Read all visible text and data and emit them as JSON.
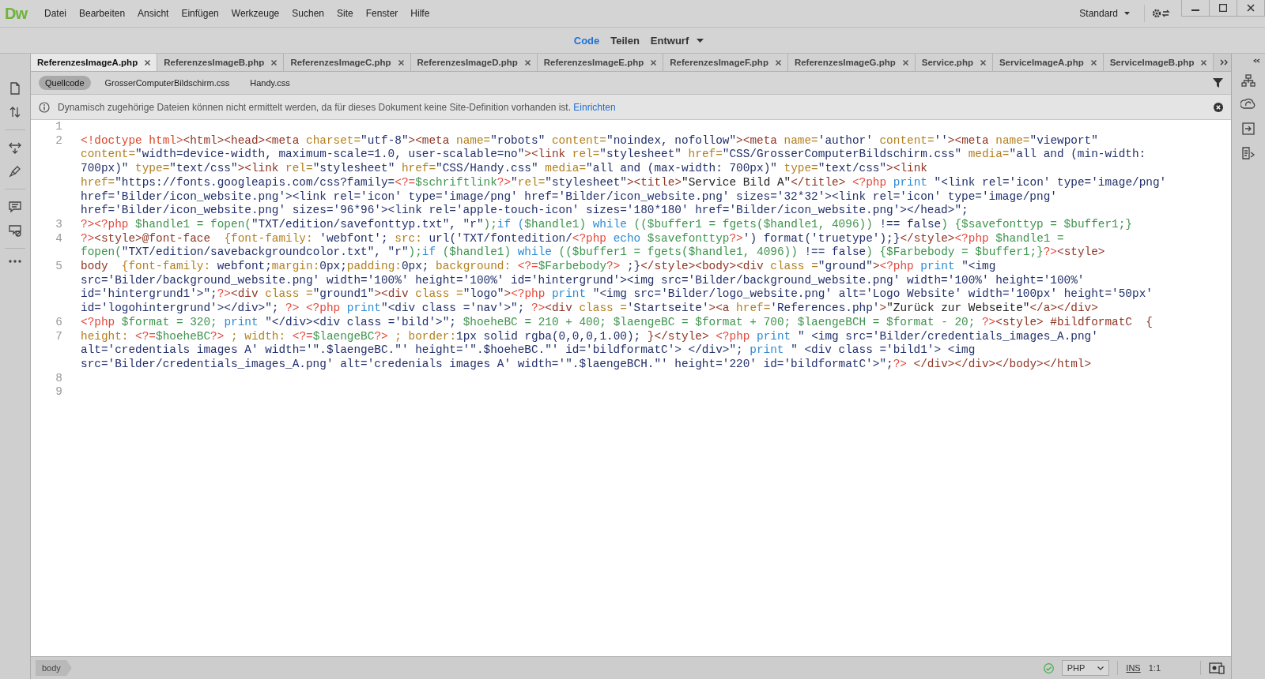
{
  "menu_bar": {
    "logo": "Dw",
    "items": [
      "Datei",
      "Bearbeiten",
      "Ansicht",
      "Einfügen",
      "Werkzeuge",
      "Suchen",
      "Site",
      "Fenster",
      "Hilfe"
    ],
    "workspace": "Standard"
  },
  "view_switch": [
    {
      "label": "Code",
      "selected": true
    },
    {
      "label": "Teilen",
      "selected": false
    },
    {
      "label": "Entwurf",
      "selected": false
    }
  ],
  "document_tabs": [
    {
      "label": "ReferenzesImageA.php",
      "selected": true
    },
    {
      "label": "ReferenzesImageB.php",
      "selected": false
    },
    {
      "label": "ReferenzesImageC.php",
      "selected": false
    },
    {
      "label": "ReferenzesImageD.php",
      "selected": false
    },
    {
      "label": "ReferenzesImageE.php",
      "selected": false
    },
    {
      "label": "ReferenzesImageF.php",
      "selected": false
    },
    {
      "label": "ReferenzesImageG.php",
      "selected": false
    },
    {
      "label": "Service.php",
      "selected": false
    },
    {
      "label": "ServiceImageA.php",
      "selected": false
    },
    {
      "label": "ServiceImageB.php",
      "selected": false
    }
  ],
  "related_files": [
    {
      "label": "Quellcode",
      "selected": true
    },
    {
      "label": "GrosserComputerBildschirm.css",
      "selected": false
    },
    {
      "label": "Handy.css",
      "selected": false
    }
  ],
  "info_bar": {
    "message": "Dynamisch zugehörige Dateien können nicht ermittelt werden, da für dieses Dokument keine Site-Definition vorhanden ist.",
    "link": "Einrichten"
  },
  "code": {
    "lines": [
      {
        "number": "1"
      },
      {
        "number": "2",
        "rows": [
          {
            "tokens": [
              {
                "kind": "doctype",
                "text": "<!doctype html>"
              },
              {
                "kind": "tag",
                "text": "<html><head><meta "
              },
              {
                "kind": "attr",
                "text": "charset="
              },
              {
                "kind": "str",
                "text": "\"utf-8\""
              },
              {
                "kind": "tag",
                "text": "><meta "
              },
              {
                "kind": "attr",
                "text": "name="
              },
              {
                "kind": "str",
                "text": "\"robots\" "
              },
              {
                "kind": "attr",
                "text": "content="
              },
              {
                "kind": "str",
                "text": "\"noindex, nofollow\""
              },
              {
                "kind": "tag",
                "text": "><meta "
              },
              {
                "kind": "attr",
                "text": "name="
              },
              {
                "kind": "str",
                "text": "'author' "
              },
              {
                "kind": "attr",
                "text": "content="
              },
              {
                "kind": "str",
                "text": "''"
              },
              {
                "kind": "tag",
                "text": "><meta "
              },
              {
                "kind": "attr",
                "text": "name="
              },
              {
                "kind": "str",
                "text": "\"viewport\""
              }
            ]
          },
          {
            "tokens": [
              {
                "kind": "attr",
                "text": "content="
              },
              {
                "kind": "str",
                "text": "\"width=device-width, maximum-scale=1.0, user-scalable=no\""
              },
              {
                "kind": "tag",
                "text": "><link "
              },
              {
                "kind": "attr",
                "text": "rel="
              },
              {
                "kind": "str",
                "text": "\"stylesheet\" "
              },
              {
                "kind": "attr",
                "text": "href="
              },
              {
                "kind": "str",
                "text": "\"CSS/GrosserComputerBildschirm.css\" "
              },
              {
                "kind": "attr",
                "text": "media="
              },
              {
                "kind": "str",
                "text": "\"all and (min-width:"
              }
            ]
          },
          {
            "tokens": [
              {
                "kind": "str",
                "text": "700px)\" "
              },
              {
                "kind": "attr",
                "text": "type="
              },
              {
                "kind": "str",
                "text": "\"text/css\""
              },
              {
                "kind": "tag",
                "text": "><link "
              },
              {
                "kind": "attr",
                "text": "rel="
              },
              {
                "kind": "str",
                "text": "\"stylesheet\" "
              },
              {
                "kind": "attr",
                "text": "href="
              },
              {
                "kind": "str",
                "text": "\"CSS/Handy.css\" "
              },
              {
                "kind": "attr",
                "text": "media="
              },
              {
                "kind": "str",
                "text": "\"all and (max-width: 700px)\" "
              },
              {
                "kind": "attr",
                "text": "type="
              },
              {
                "kind": "str",
                "text": "\"text/css\""
              },
              {
                "kind": "tag",
                "text": "><link"
              }
            ]
          },
          {
            "tokens": [
              {
                "kind": "attr",
                "text": "href="
              },
              {
                "kind": "str",
                "text": "\"https://fonts.googleapis.com/css?family="
              },
              {
                "kind": "php",
                "text": "<?="
              },
              {
                "kind": "var",
                "text": "$schriftlink"
              },
              {
                "kind": "php",
                "text": "?>"
              },
              {
                "kind": "str",
                "text": "\""
              },
              {
                "kind": "attr",
                "text": "rel="
              },
              {
                "kind": "str",
                "text": "\"stylesheet\""
              },
              {
                "kind": "tag",
                "text": "><title>"
              },
              {
                "kind": "plain",
                "text": "\"Service Bild A\""
              },
              {
                "kind": "tag",
                "text": "</title> "
              },
              {
                "kind": "php",
                "text": "<?php "
              },
              {
                "kind": "kw",
                "text": "print "
              },
              {
                "kind": "str",
                "text": "\"<link rel='icon' type='image/png'"
              }
            ]
          },
          {
            "tokens": [
              {
                "kind": "str",
                "text": "href='Bilder/icon_website.png'><link rel='icon' type='image/png' href='Bilder/icon_website.png' sizes='32*32'><link rel='icon' type='image/png'"
              }
            ]
          },
          {
            "tokens": [
              {
                "kind": "str",
                "text": "href='Bilder/icon_website.png' sizes='96*96'><link rel='apple-touch-icon' sizes='180*180' href='Bilder/icon_website.png'></head>\";"
              }
            ]
          }
        ]
      },
      {
        "number": "3",
        "rows": [
          {
            "tokens": [
              {
                "kind": "php",
                "text": "?><?php "
              },
              {
                "kind": "var",
                "text": "$handle1 = fopen("
              },
              {
                "kind": "str",
                "text": "\"TXT/edition/savefonttyp.txt\", \"r\""
              },
              {
                "kind": "var",
                "text": ");"
              },
              {
                "kind": "kw",
                "text": "if ("
              },
              {
                "kind": "var",
                "text": "$handle1) "
              },
              {
                "kind": "kw",
                "text": "while "
              },
              {
                "kind": "var",
                "text": "(($buffer1 = fgets($handle1, 4096)) "
              },
              {
                "kind": "str",
                "text": "!== false"
              },
              {
                "kind": "var",
                "text": ") {$savefonttyp = $buffer1;}"
              }
            ]
          }
        ]
      },
      {
        "number": "4",
        "rows": [
          {
            "tokens": [
              {
                "kind": "php",
                "text": "?>"
              },
              {
                "kind": "tag",
                "text": "<style>@font-face  "
              },
              {
                "kind": "attr",
                "text": "{font-family: "
              },
              {
                "kind": "str",
                "text": "'webfont'; "
              },
              {
                "kind": "attr",
                "text": "src: "
              },
              {
                "kind": "str",
                "text": "url('TXT/fontedition/"
              },
              {
                "kind": "php",
                "text": "<?php "
              },
              {
                "kind": "kw",
                "text": "echo "
              },
              {
                "kind": "var",
                "text": "$savefonttyp"
              },
              {
                "kind": "php",
                "text": "?>"
              },
              {
                "kind": "str",
                "text": "') format('truetype');}"
              },
              {
                "kind": "tag",
                "text": "</style>"
              },
              {
                "kind": "php",
                "text": "<?php "
              },
              {
                "kind": "var",
                "text": "$handle1 ="
              }
            ]
          },
          {
            "tokens": [
              {
                "kind": "var",
                "text": "fopen("
              },
              {
                "kind": "str",
                "text": "\"TXT/edition/savebackgroundcolor.txt\", \"r\""
              },
              {
                "kind": "var",
                "text": ");"
              },
              {
                "kind": "kw",
                "text": "if "
              },
              {
                "kind": "var",
                "text": "($handle1) "
              },
              {
                "kind": "kw",
                "text": "while "
              },
              {
                "kind": "var",
                "text": "(($buffer1 = fgets($handle1, 4096)) "
              },
              {
                "kind": "str",
                "text": "!== false"
              },
              {
                "kind": "var",
                "text": ") {$Farbebody = $buffer1;}"
              },
              {
                "kind": "php",
                "text": "?>"
              },
              {
                "kind": "tag",
                "text": "<style>"
              }
            ]
          }
        ]
      },
      {
        "number": "5",
        "rows": [
          {
            "tokens": [
              {
                "kind": "tag",
                "text": "body  "
              },
              {
                "kind": "attr",
                "text": "{font-family: "
              },
              {
                "kind": "str",
                "text": "webfont;"
              },
              {
                "kind": "attr",
                "text": "margin:"
              },
              {
                "kind": "str",
                "text": "0px;"
              },
              {
                "kind": "attr",
                "text": "padding:"
              },
              {
                "kind": "str",
                "text": "0px; "
              },
              {
                "kind": "attr",
                "text": "background: "
              },
              {
                "kind": "php",
                "text": "<?="
              },
              {
                "kind": "var",
                "text": "$Farbebody"
              },
              {
                "kind": "php",
                "text": "?>"
              },
              {
                "kind": "str",
                "text": " ;}"
              },
              {
                "kind": "tag",
                "text": "</style><body><div "
              },
              {
                "kind": "attr",
                "text": "class ="
              },
              {
                "kind": "str",
                "text": "\"ground\""
              },
              {
                "kind": "tag",
                "text": ">"
              },
              {
                "kind": "php",
                "text": "<?php "
              },
              {
                "kind": "kw",
                "text": "print "
              },
              {
                "kind": "str",
                "text": "\"<img"
              }
            ]
          },
          {
            "tokens": [
              {
                "kind": "str",
                "text": "src='Bilder/background_website.png' width='100%' height='100%' id='hintergrund'><img src='Bilder/background_website.png' width='100%' height='100%'"
              }
            ]
          },
          {
            "tokens": [
              {
                "kind": "str",
                "text": "id='hintergrund1'>\";"
              },
              {
                "kind": "php",
                "text": "?>"
              },
              {
                "kind": "tag",
                "text": "<div "
              },
              {
                "kind": "attr",
                "text": "class ="
              },
              {
                "kind": "str",
                "text": "\"ground1\""
              },
              {
                "kind": "tag",
                "text": "><div "
              },
              {
                "kind": "attr",
                "text": "class ="
              },
              {
                "kind": "str",
                "text": "\"logo\""
              },
              {
                "kind": "tag",
                "text": ">"
              },
              {
                "kind": "php",
                "text": "<?php "
              },
              {
                "kind": "kw",
                "text": "print "
              },
              {
                "kind": "str",
                "text": "\"<img src='Bilder/logo_website.png' alt='Logo Website' width='100px' height='50px'"
              }
            ]
          },
          {
            "tokens": [
              {
                "kind": "str",
                "text": "id='logohintergrund'></div>\"; "
              },
              {
                "kind": "php",
                "text": "?> <?php "
              },
              {
                "kind": "kw",
                "text": "print"
              },
              {
                "kind": "str",
                "text": "\"<div class ='nav'>\"; "
              },
              {
                "kind": "php",
                "text": "?>"
              },
              {
                "kind": "tag",
                "text": "<div "
              },
              {
                "kind": "attr",
                "text": "class ="
              },
              {
                "kind": "str",
                "text": "'Startseite'"
              },
              {
                "kind": "tag",
                "text": "><a "
              },
              {
                "kind": "attr",
                "text": "href="
              },
              {
                "kind": "str",
                "text": "'References.php'"
              },
              {
                "kind": "tag",
                "text": ">"
              },
              {
                "kind": "plain",
                "text": "\"Zurück zur Webseite\""
              },
              {
                "kind": "tag",
                "text": "</a></div>"
              }
            ]
          }
        ]
      },
      {
        "number": "6",
        "rows": [
          {
            "tokens": [
              {
                "kind": "php",
                "text": "<?php "
              },
              {
                "kind": "var",
                "text": "$format = 320; "
              },
              {
                "kind": "kw",
                "text": "print "
              },
              {
                "kind": "str",
                "text": "\"</div><div class ='bild'>\"; "
              },
              {
                "kind": "var",
                "text": "$hoeheBC = 210 + 400; $laengeBC = $format + 700; $laengeBCH = $format - 20; "
              },
              {
                "kind": "php",
                "text": "?>"
              },
              {
                "kind": "tag",
                "text": "<style> #bildformatC  {"
              }
            ]
          }
        ]
      },
      {
        "number": "7",
        "rows": [
          {
            "tokens": [
              {
                "kind": "attr",
                "text": "height: "
              },
              {
                "kind": "php",
                "text": "<?="
              },
              {
                "kind": "var",
                "text": "$hoeheBC"
              },
              {
                "kind": "php",
                "text": "?>"
              },
              {
                "kind": "attr",
                "text": " ; width: "
              },
              {
                "kind": "php",
                "text": "<?="
              },
              {
                "kind": "var",
                "text": "$laengeBC"
              },
              {
                "kind": "php",
                "text": "?>"
              },
              {
                "kind": "attr",
                "text": " ; border:"
              },
              {
                "kind": "str",
                "text": "1px solid rgba(0,0,0,1.00); "
              },
              {
                "kind": "tag",
                "text": "}</style> "
              },
              {
                "kind": "php",
                "text": "<?php "
              },
              {
                "kind": "kw",
                "text": "print "
              },
              {
                "kind": "str",
                "text": "\" <img src='Bilder/credentials_images_A.png'"
              }
            ]
          },
          {
            "tokens": [
              {
                "kind": "str",
                "text": "alt='credentials images A' width='\".$laengeBC.\"' height='\".$hoeheBC.\"' id='bildformatC'> </div>\"; "
              },
              {
                "kind": "kw",
                "text": "print "
              },
              {
                "kind": "str",
                "text": "\" <div class ='bild1'> <img"
              }
            ]
          },
          {
            "tokens": [
              {
                "kind": "str",
                "text": "src='Bilder/credentials_images_A.png' alt='credenials images A' width='\".$laengeBCH.\"' height='220' id='bildformatC'>\";"
              },
              {
                "kind": "php",
                "text": "?>"
              },
              {
                "kind": "tag",
                "text": " </div></div></body></html>"
              }
            ]
          }
        ]
      },
      {
        "number": "8"
      },
      {
        "number": "9"
      }
    ]
  },
  "status_bar": {
    "tag": "body",
    "language": "PHP",
    "mode": "INS",
    "ratio": "1:1"
  }
}
